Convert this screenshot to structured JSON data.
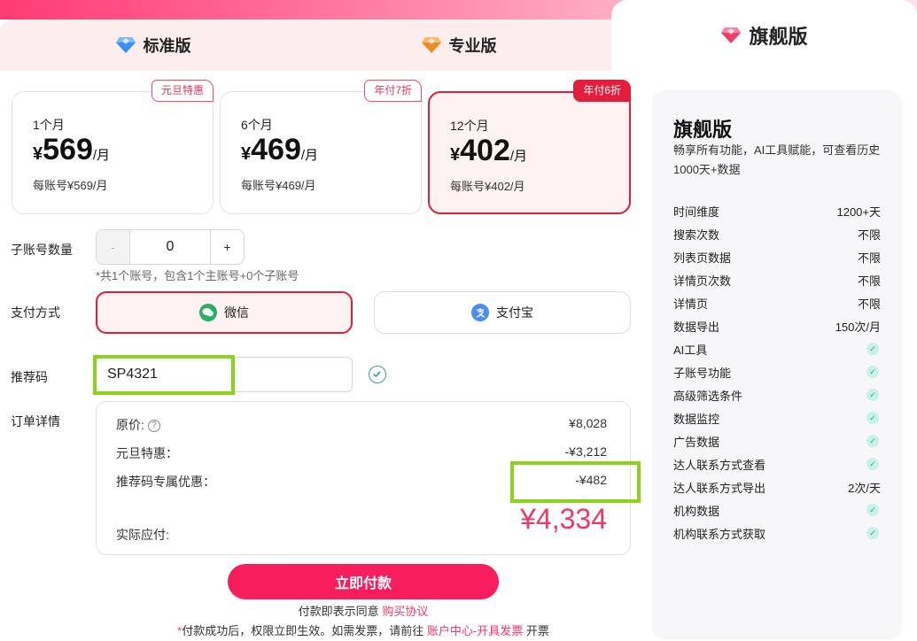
{
  "tabs": [
    {
      "label": "标准版",
      "gem_color": "#3a8ef0"
    },
    {
      "label": "专业版",
      "gem_color": "#f08a24"
    },
    {
      "label": "旗舰版",
      "gem_color": "#ef3d68"
    }
  ],
  "plans": [
    {
      "badge": "元旦特惠",
      "term": "1个月",
      "currency": "¥",
      "price": "569",
      "unit": "/月",
      "per_account": "每账号¥569/月"
    },
    {
      "badge": "年付7折",
      "term": "6个月",
      "currency": "¥",
      "price": "469",
      "unit": "/月",
      "per_account": "每账号¥469/月"
    },
    {
      "badge": "年付6折",
      "term": "12个月",
      "currency": "¥",
      "price": "402",
      "unit": "/月",
      "per_account": "每账号¥402/月"
    }
  ],
  "sub_accounts": {
    "label": "子账号数量",
    "minus": "-",
    "value": "0",
    "plus": "+",
    "hint": "*共1个账号，包含1个主账号+0个子账号"
  },
  "payment": {
    "label": "支付方式",
    "wechat": "微信",
    "alipay": "支付宝"
  },
  "referral": {
    "label": "推荐码",
    "value": "SP4321"
  },
  "order": {
    "label": "订单详情",
    "original_label": "原价:",
    "original_value": "¥8,028",
    "promo_label": "元旦特惠：",
    "promo_value": "-¥3,212",
    "ref_label": "推荐码专属优惠：",
    "ref_value": "-¥482",
    "pay_label": "实际应付:",
    "pay_value": "¥4,334"
  },
  "submit": "立即付款",
  "agree": {
    "text": "付款即表示同意",
    "link": "购买协议"
  },
  "footer": {
    "star": "*",
    "text1": "付款成功后，权限立即生效。如需发票，请前往",
    "link": "账户中心-开具发票",
    "text2": "开票"
  },
  "sidebar": {
    "title": "旗舰版",
    "desc": "畅享所有功能，AI工具赋能，可查看历史1000天+数据",
    "features": [
      {
        "name": "时间维度",
        "value": "1200+天"
      },
      {
        "name": "搜索次数",
        "value": "不限"
      },
      {
        "name": "列表页数据",
        "value": "不限"
      },
      {
        "name": "详情页次数",
        "value": "不限"
      },
      {
        "name": "详情页",
        "value": "不限"
      },
      {
        "name": "数据导出",
        "value": "150次/月"
      },
      {
        "name": "AI工具",
        "value": ""
      },
      {
        "name": "子账号功能",
        "value": ""
      },
      {
        "name": "高级筛选条件",
        "value": ""
      },
      {
        "name": "数据监控",
        "value": ""
      },
      {
        "name": "广告数据",
        "value": ""
      },
      {
        "name": "达人联系方式查看",
        "value": ""
      },
      {
        "name": "达人联系方式导出",
        "value": "2次/天"
      },
      {
        "name": "机构数据",
        "value": ""
      },
      {
        "name": "机构联系方式获取",
        "value": ""
      }
    ]
  },
  "colors": {
    "accent": "#f81d5d",
    "selected_border": "#e51d3c",
    "highlight": "#8bd41a",
    "wechat": "#2aae67",
    "alipay": "#1677ff"
  }
}
